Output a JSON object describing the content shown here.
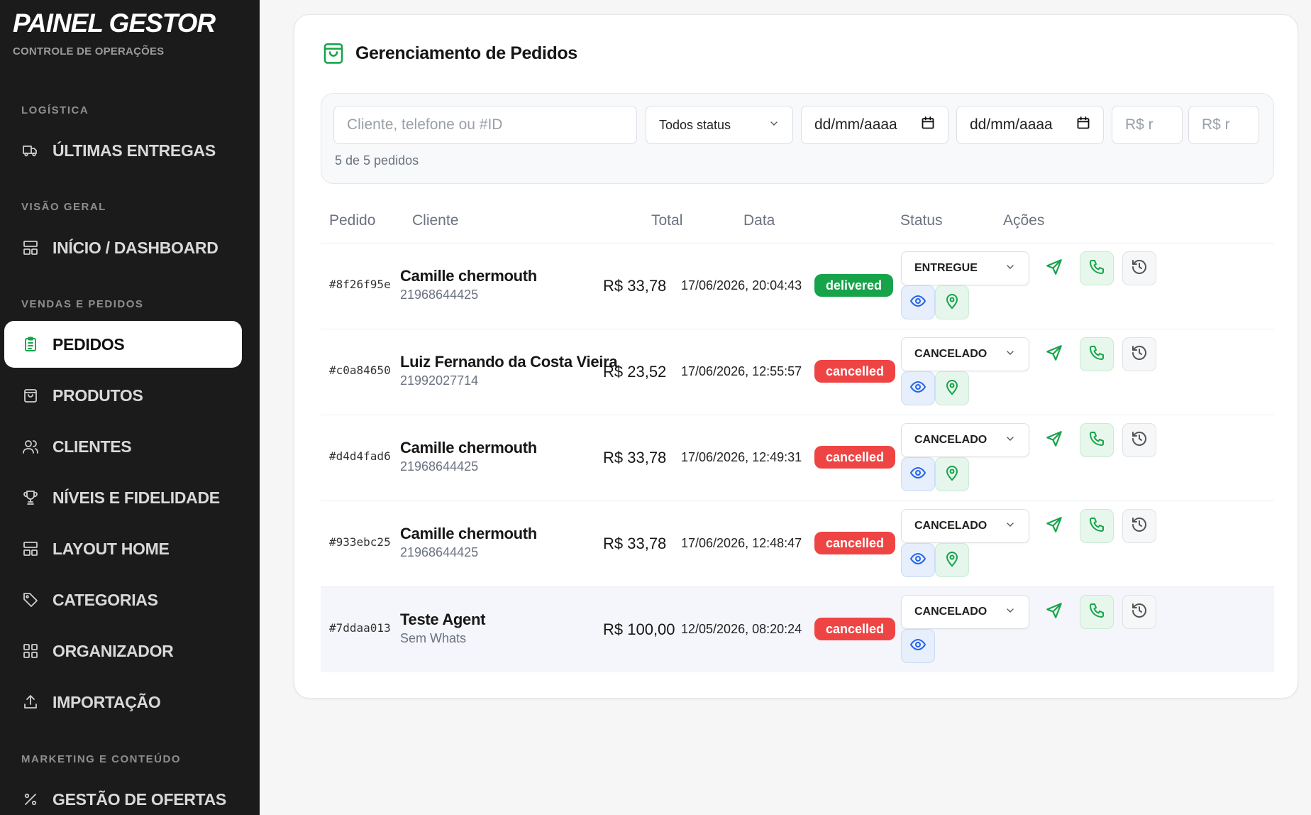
{
  "sidebar": {
    "brand_title": "PAINEL GESTOR",
    "brand_subtitle": "CONTROLE DE OPERAÇÕES",
    "sections": {
      "logistica": "LOGÍSTICA",
      "visao_geral": "VISÃO GERAL",
      "vendas": "VENDAS E PEDIDOS",
      "marketing": "MARKETING E CONTEÚDO"
    },
    "items": [
      {
        "label": "ÚLTIMAS ENTREGAS",
        "icon": "truck-icon"
      },
      {
        "label": "INÍCIO / DASHBOARD",
        "icon": "layout-icon"
      },
      {
        "label": "PEDIDOS",
        "icon": "clipboard-icon",
        "active": true
      },
      {
        "label": "PRODUTOS",
        "icon": "bag-icon"
      },
      {
        "label": "CLIENTES",
        "icon": "users-icon"
      },
      {
        "label": "NÍVEIS E FIDELIDADE",
        "icon": "trophy-icon"
      },
      {
        "label": "LAYOUT HOME",
        "icon": "layout-icon"
      },
      {
        "label": "CATEGORIAS",
        "icon": "tag-icon"
      },
      {
        "label": "ORGANIZADOR",
        "icon": "grid-icon"
      },
      {
        "label": "IMPORTAÇÃO",
        "icon": "upload-icon"
      },
      {
        "label": "GESTÃO DE OFERTAS",
        "icon": "percent-icon"
      }
    ]
  },
  "main": {
    "title": "Gerenciamento de Pedidos",
    "filters": {
      "search_placeholder": "Cliente, telefone ou #ID",
      "status_value": "Todos status",
      "date_from": "dd/mm/aaaa",
      "date_to": "dd/mm/aaaa",
      "min_placeholder": "R$ r",
      "max_placeholder": "R$ r",
      "count_text": "5 de 5 pedidos"
    },
    "columns": {
      "pedido": "Pedido",
      "cliente": "Cliente",
      "total": "Total",
      "data": "Data",
      "status": "Status",
      "acoes": "Ações"
    },
    "orders": [
      {
        "id": "#8f26f95e",
        "name": "Camille chermouth",
        "phone": "21968644425",
        "total": "R$ 33,78",
        "date": "17/06/2026, 20:04:43",
        "status": "delivered",
        "status_color": "#16a34a",
        "select": "ENTREGUE",
        "has_location": true
      },
      {
        "id": "#c0a84650",
        "name": "Luiz Fernando da Costa Vieira",
        "phone": "21992027714",
        "total": "R$ 23,52",
        "date": "17/06/2026, 12:55:57",
        "status": "cancelled",
        "status_color": "#ef4444",
        "select": "CANCELADO",
        "has_location": true
      },
      {
        "id": "#d4d4fad6",
        "name": "Camille chermouth",
        "phone": "21968644425",
        "total": "R$ 33,78",
        "date": "17/06/2026, 12:49:31",
        "status": "cancelled",
        "status_color": "#ef4444",
        "select": "CANCELADO",
        "has_location": true
      },
      {
        "id": "#933ebc25",
        "name": "Camille chermouth",
        "phone": "21968644425",
        "total": "R$ 33,78",
        "date": "17/06/2026, 12:48:47",
        "status": "cancelled",
        "status_color": "#ef4444",
        "select": "CANCELADO",
        "has_location": true
      },
      {
        "id": "#7ddaa013",
        "name": "Teste Agent",
        "phone": "Sem Whats",
        "total": "R$ 100,00",
        "date": "12/05/2026, 08:20:24",
        "status": "cancelled",
        "status_color": "#ef4444",
        "select": "CANCELADO",
        "has_location": false
      }
    ]
  },
  "colors": {
    "sidebar_bg": "#1b1b1b",
    "accent_green": "#16a34a",
    "danger_red": "#ef4444",
    "eye_blue": "#2563eb"
  }
}
